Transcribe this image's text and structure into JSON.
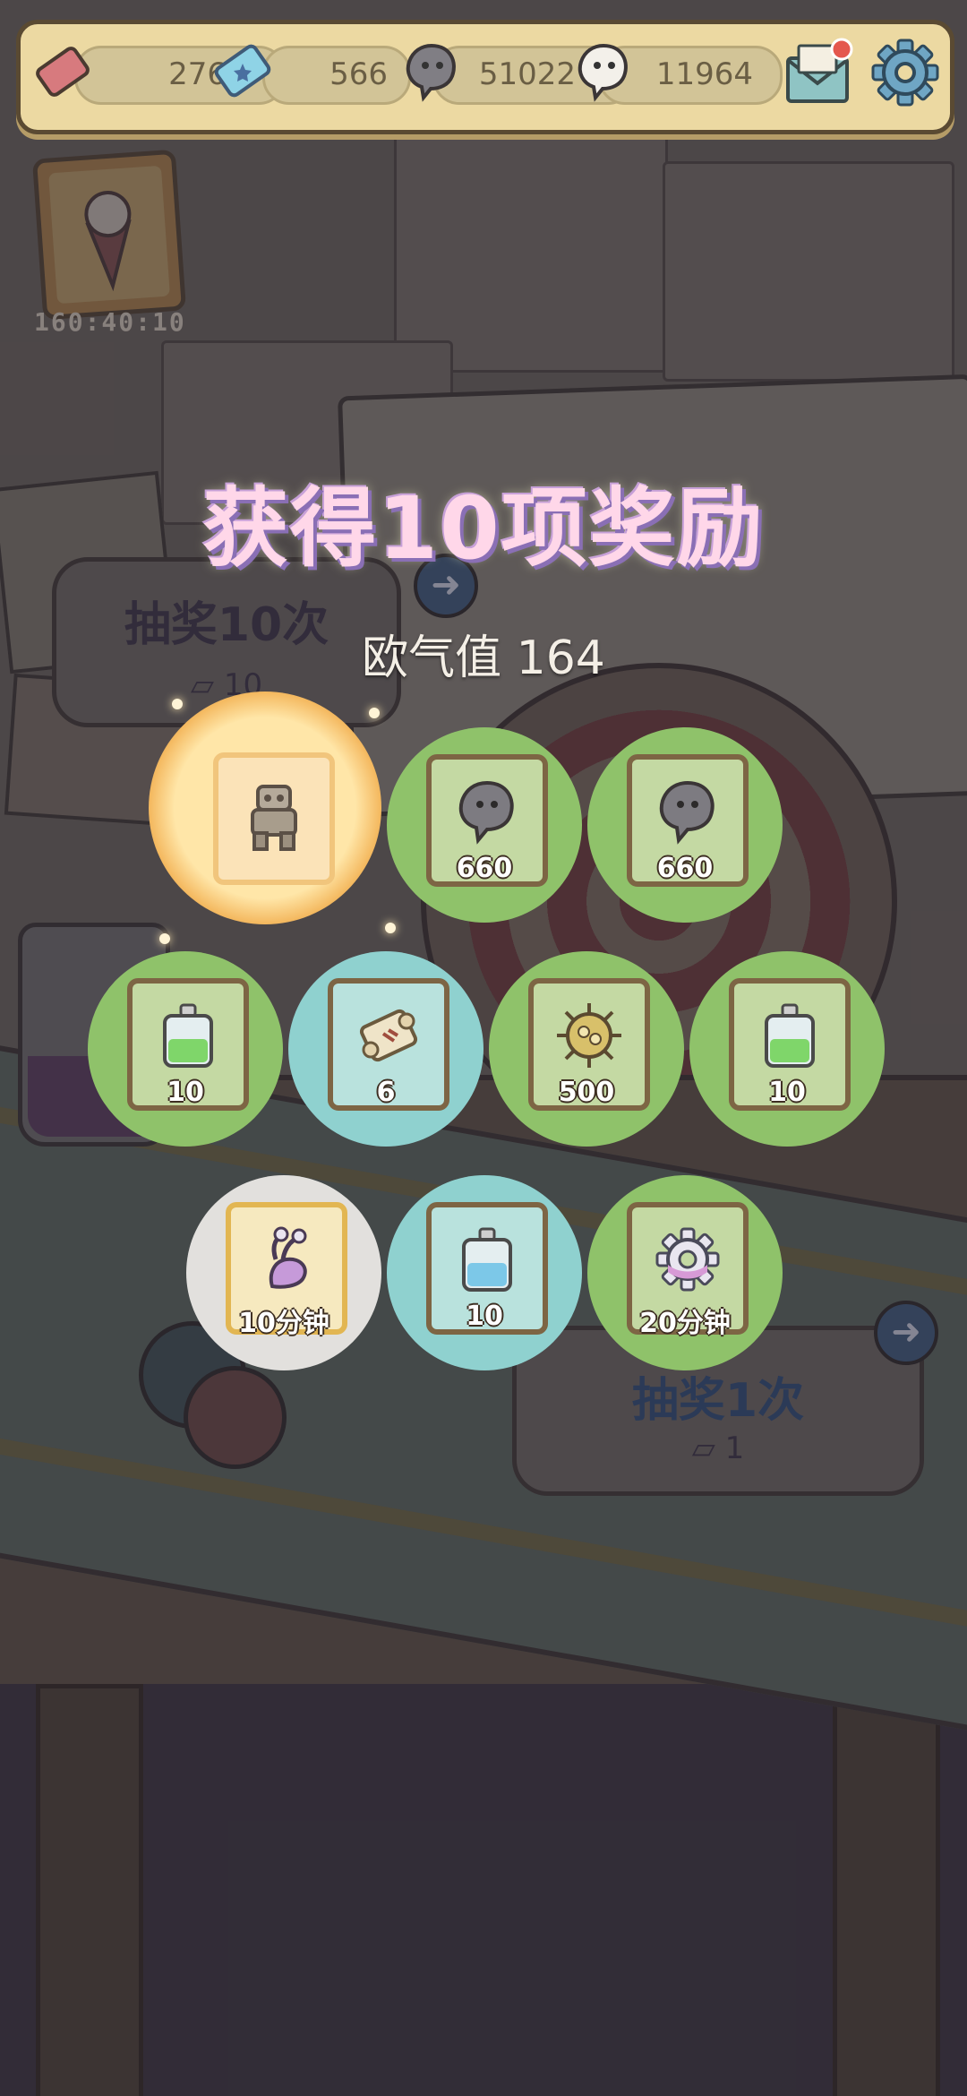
{
  "currencies": [
    {
      "icon": "ticket-red-icon",
      "value": "276"
    },
    {
      "icon": "ticket-blue-icon",
      "value": "566"
    },
    {
      "icon": "gray-blob-icon",
      "value": "51022"
    },
    {
      "icon": "white-blob-icon",
      "value": "11964"
    }
  ],
  "event": {
    "timer": "160:40:10"
  },
  "draw10": {
    "label": "抽奖10次",
    "cost": "10"
  },
  "draw1": {
    "label": "抽奖1次",
    "cost": "1"
  },
  "overlay": {
    "title": "获得10项奖励",
    "luck_label": "欧气值",
    "luck_value": "164"
  },
  "rewards": [
    {
      "icon": "stone-golem-icon",
      "amount": "",
      "bg": "gold"
    },
    {
      "icon": "gray-blob-icon",
      "amount": "660",
      "bg": "green"
    },
    {
      "icon": "gray-blob-icon",
      "amount": "660",
      "bg": "green"
    },
    {
      "icon": "green-potion-icon",
      "amount": "10",
      "bg": "green"
    },
    {
      "icon": "scroll-icon",
      "amount": "6",
      "bg": "blue"
    },
    {
      "icon": "virus-gear-icon",
      "amount": "500",
      "bg": "green"
    },
    {
      "icon": "green-potion-icon",
      "amount": "10",
      "bg": "green"
    },
    {
      "icon": "purple-snail-icon",
      "amount": "10分钟",
      "bg": "white"
    },
    {
      "icon": "blue-potion-icon",
      "amount": "10",
      "bg": "blue"
    },
    {
      "icon": "gear-cog-icon",
      "amount": "20分钟",
      "bg": "green"
    }
  ]
}
